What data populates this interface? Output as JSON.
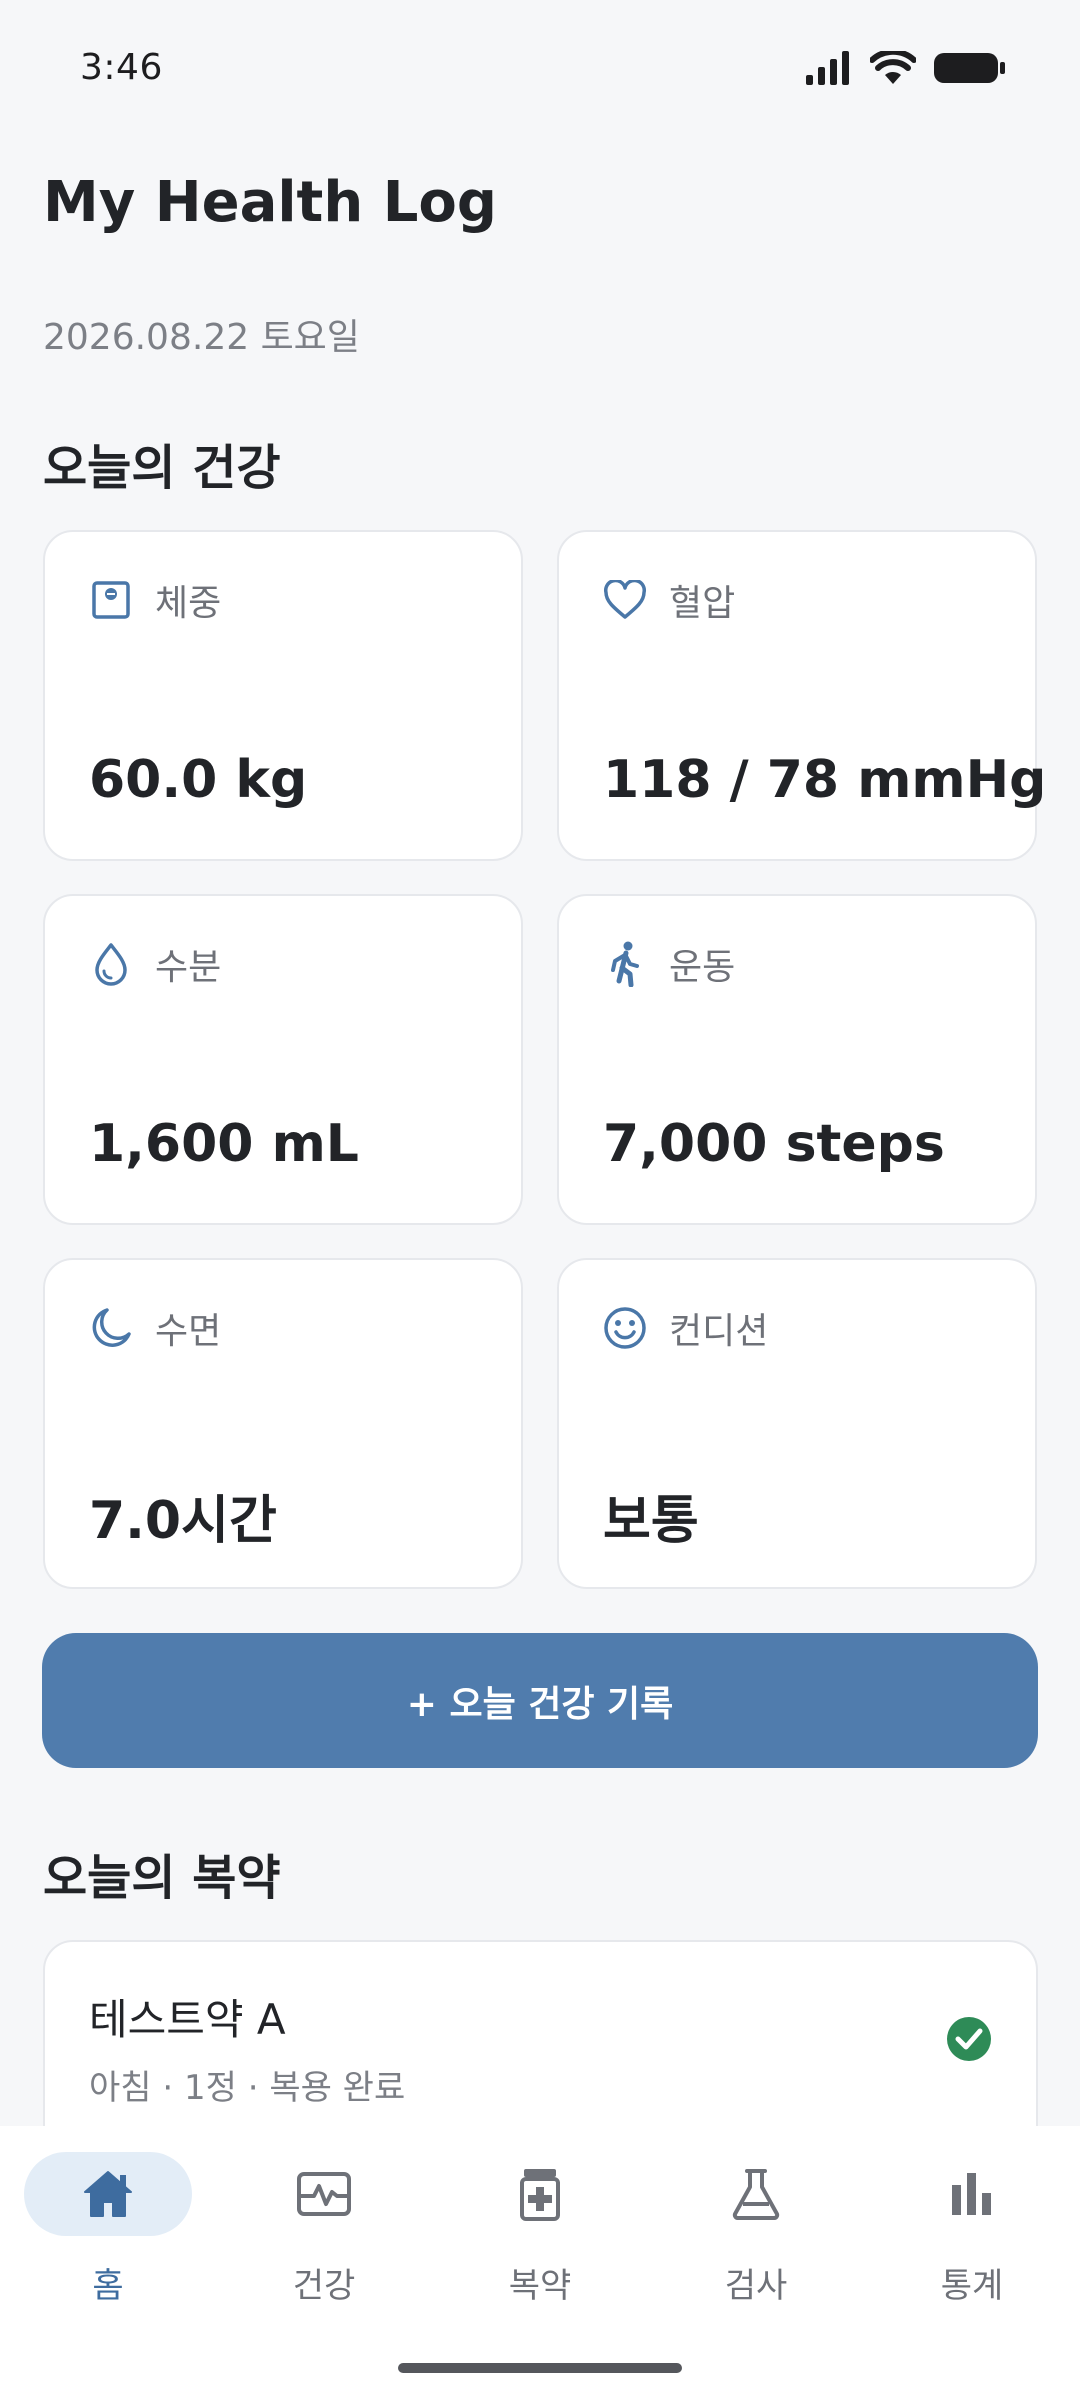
{
  "status_bar": {
    "time": "3:46"
  },
  "header": {
    "title": "My Health Log",
    "date": "2026.08.22 토요일"
  },
  "today_health": {
    "title": "오늘의 건강",
    "cards": [
      {
        "label": "체중",
        "value": "60.0 kg",
        "icon": "scale-icon"
      },
      {
        "label": "혈압",
        "value": "118 / 78 mmHg",
        "icon": "heart-icon"
      },
      {
        "label": "수분",
        "value": "1,600 mL",
        "icon": "water-drop-icon"
      },
      {
        "label": "운동",
        "value": "7,000 steps",
        "icon": "walking-icon"
      },
      {
        "label": "수면",
        "value": "7.0시간",
        "icon": "moon-icon"
      },
      {
        "label": "컨디션",
        "value": "보통",
        "icon": "smiley-icon"
      }
    ]
  },
  "add_record_label": "+ 오늘 건강 기록",
  "medication": {
    "title": "오늘의 복약",
    "items": [
      {
        "name": "테스트약 A",
        "detail": "아침 · 1정 · 복용 완료",
        "status": "completed"
      }
    ]
  },
  "nav": {
    "items": [
      {
        "label": "홈",
        "icon": "home-icon",
        "active": true
      },
      {
        "label": "건강",
        "icon": "health-monitor-icon",
        "active": false
      },
      {
        "label": "복약",
        "icon": "medicine-icon",
        "active": false
      },
      {
        "label": "검사",
        "icon": "flask-icon",
        "active": false
      },
      {
        "label": "통계",
        "icon": "bar-chart-icon",
        "active": false
      }
    ]
  },
  "colors": {
    "accent": "#507cad",
    "icon": "#4a77a8",
    "success": "#2e8b57",
    "background": "#f6f7f9"
  }
}
